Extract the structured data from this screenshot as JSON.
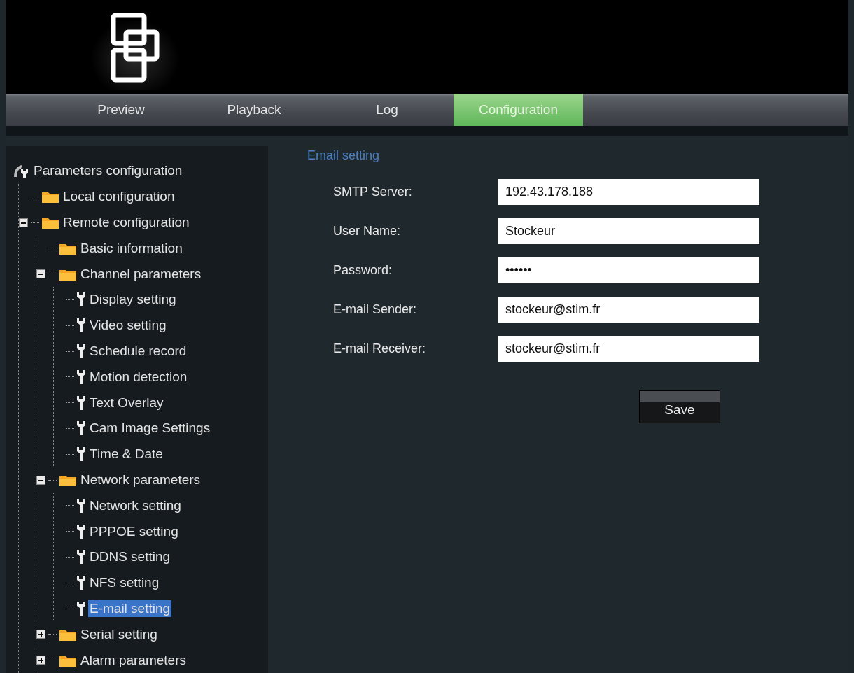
{
  "tabs": [
    {
      "label": "Preview",
      "selected": false
    },
    {
      "label": "Playback",
      "selected": false
    },
    {
      "label": "Log",
      "selected": false
    },
    {
      "label": "Configuration",
      "selected": true
    }
  ],
  "tree": [
    {
      "kind": "root",
      "label": "Parameters configuration",
      "selected": false,
      "children": [
        {
          "kind": "folder",
          "label": "Local configuration",
          "selected": false
        },
        {
          "kind": "folder",
          "label": "Remote configuration",
          "selected": false,
          "expanded": true,
          "children": [
            {
              "kind": "folder",
              "label": "Basic information",
              "selected": false
            },
            {
              "kind": "folder",
              "label": "Channel parameters",
              "selected": false,
              "expanded": true,
              "children": [
                {
                  "kind": "setting",
                  "label": "Display setting",
                  "selected": false
                },
                {
                  "kind": "setting",
                  "label": "Video setting",
                  "selected": false
                },
                {
                  "kind": "setting",
                  "label": "Schedule record",
                  "selected": false
                },
                {
                  "kind": "setting",
                  "label": "Motion detection",
                  "selected": false
                },
                {
                  "kind": "setting",
                  "label": "Text Overlay",
                  "selected": false
                },
                {
                  "kind": "setting",
                  "label": "Cam Image Settings",
                  "selected": false
                },
                {
                  "kind": "setting",
                  "label": "Time & Date",
                  "selected": false
                }
              ]
            },
            {
              "kind": "folder",
              "label": "Network parameters",
              "selected": false,
              "expanded": true,
              "children": [
                {
                  "kind": "setting",
                  "label": "Network setting",
                  "selected": false
                },
                {
                  "kind": "setting",
                  "label": "PPPOE setting",
                  "selected": false
                },
                {
                  "kind": "setting",
                  "label": "DDNS setting",
                  "selected": false
                },
                {
                  "kind": "setting",
                  "label": "NFS setting",
                  "selected": false
                },
                {
                  "kind": "setting",
                  "label": "E-mail setting",
                  "selected": true
                }
              ]
            },
            {
              "kind": "folder",
              "label": "Serial setting",
              "selected": false,
              "expanded": false
            },
            {
              "kind": "folder",
              "label": "Alarm parameters",
              "selected": false,
              "expanded": false
            }
          ]
        }
      ]
    }
  ],
  "form": {
    "title": "Email setting",
    "fields": [
      {
        "label": "SMTP Server:",
        "value": "192.43.178.188"
      },
      {
        "label": "User Name:",
        "value": "Stockeur"
      },
      {
        "label": "Password:",
        "value": "••••••"
      },
      {
        "label": "E-mail Sender:",
        "value": "stockeur@stim.fr"
      },
      {
        "label": "E-mail Receiver:",
        "value": "stockeur@stim.fr"
      }
    ],
    "save_button": "Save"
  }
}
